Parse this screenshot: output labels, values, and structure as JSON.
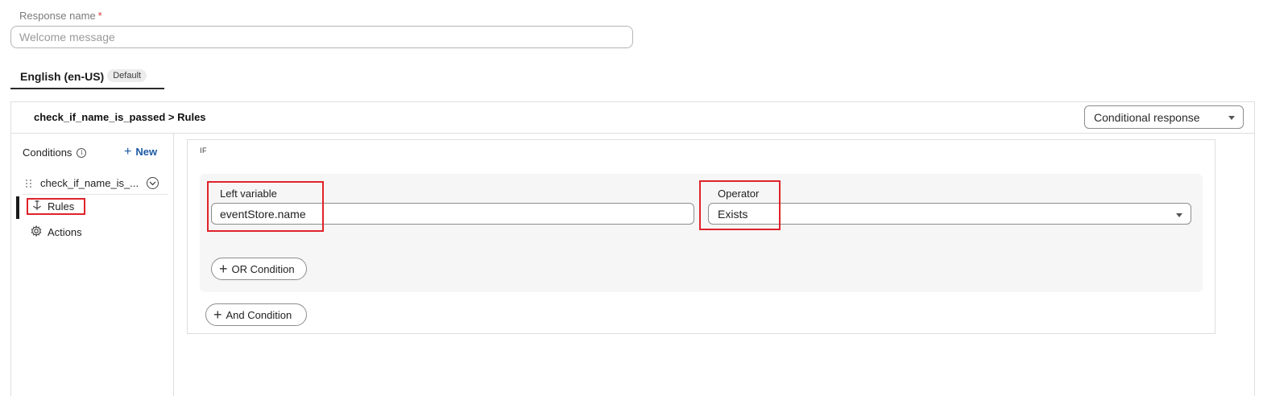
{
  "response_name": {
    "label": "Response name",
    "required_mark": "*",
    "placeholder": "Welcome message"
  },
  "language_tab": {
    "label": "English (en-US)",
    "badge": "Default"
  },
  "header": {
    "breadcrumb": "check_if_name_is_passed > Rules",
    "response_type": "Conditional response"
  },
  "sidebar": {
    "title": "Conditions",
    "new_label": "New",
    "condition_name": "check_if_name_is_...",
    "items": [
      {
        "label": "Rules",
        "icon": "rules-icon",
        "active": true
      },
      {
        "label": "Actions",
        "icon": "gear-icon",
        "active": false
      }
    ]
  },
  "editor": {
    "if_label": "IF",
    "left_variable_label": "Left variable",
    "left_variable_value": "eventStore.name",
    "operator_label": "Operator",
    "operator_value": "Exists",
    "or_condition_label": "OR Condition",
    "and_condition_label": "And Condition"
  },
  "colors": {
    "highlight": "#e0232b",
    "link": "#1d5aa3",
    "group_bg": "#f6f6f6"
  }
}
